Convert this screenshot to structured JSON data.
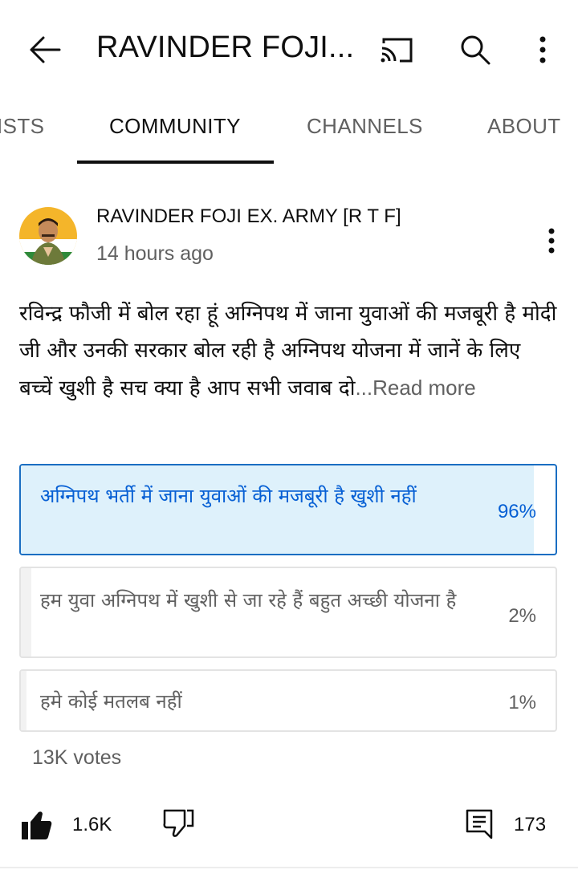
{
  "header": {
    "channel_title": "RAVINDER FOJI...",
    "icons": [
      "back-arrow-icon",
      "cast-icon",
      "search-icon",
      "more-vert-icon"
    ]
  },
  "tabs": [
    {
      "label": "ISTS",
      "active": false
    },
    {
      "label": "COMMUNITY",
      "active": true
    },
    {
      "label": "CHANNELS",
      "active": false
    },
    {
      "label": "ABOUT",
      "active": false
    }
  ],
  "post": {
    "author": "RAVINDER FOJI EX. ARMY [R T F]",
    "timestamp": "14 hours ago",
    "text": "रविन्द्र फौजी में बोल रहा हूं अग्निपथ में जाना युवाओं की मजबूरी है मोदी जी और उनकी सरकार बोल रही है अग्निपथ योजना में जानें के लिए बच्चें खुशी है  सच क्या है आप सभी जवाब दो",
    "read_more": "...Read more"
  },
  "poll": {
    "options": [
      {
        "text": "अग्निपथ भर्ती में जाना युवाओं की मजबूरी है  खुशी नहीं",
        "percent": "96%",
        "fill": 0.96,
        "selected": true
      },
      {
        "text": "हम युवा अग्निपथ में खुशी से जा रहे हैं बहुत अच्छी योजना है",
        "percent": "2%",
        "fill": 0.02,
        "selected": false
      },
      {
        "text": "हमे कोई मतलब नहीं",
        "percent": "1%",
        "fill": 0.01,
        "selected": false
      }
    ],
    "votes": "13K votes"
  },
  "actions": {
    "like_count": "1.6K",
    "comment_count": "173",
    "icons": [
      "thumb-up-filled-icon",
      "thumb-down-icon",
      "comment-icon"
    ]
  },
  "colors": {
    "accent": "#065fd4",
    "selected_border": "#1a6ec2",
    "selected_fill": "#def1fb",
    "secondary_text": "#606060"
  }
}
